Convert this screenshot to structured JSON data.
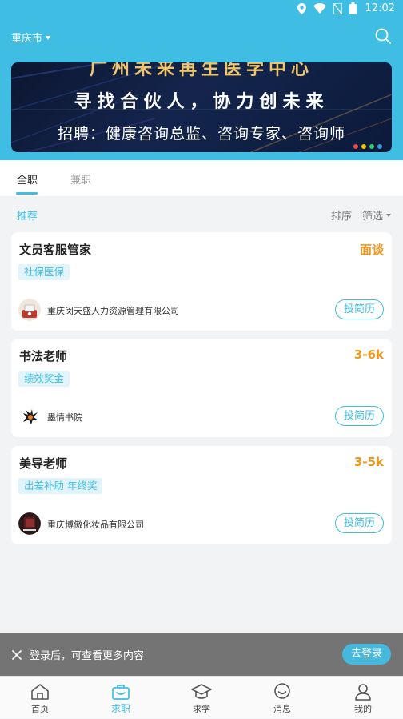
{
  "status_bar": {
    "time": "12:02"
  },
  "header": {
    "city": "重庆市"
  },
  "banner": {
    "line1": "广州未来再生医学中心",
    "line2": "寻找合伙人，协力创未来",
    "line3": "招聘：健康咨询总监、咨询专家、咨询师"
  },
  "tabs": {
    "fulltime": "全职",
    "parttime": "兼职"
  },
  "filter": {
    "recommend": "推荐",
    "sort": "排序",
    "filter": "筛选"
  },
  "jobs": [
    {
      "title": "文员客服管家",
      "salary": "面谈",
      "tag": "社保医保",
      "company": "重庆闵天盛人力资源管理有限公司",
      "apply": "投简历"
    },
    {
      "title": "书法老师",
      "salary": "3-6k",
      "tag": "绩效奖金",
      "company": "墨情书院",
      "apply": "投简历"
    },
    {
      "title": "美导老师",
      "salary": "3-5k",
      "tag": "出差补助 年终奖",
      "company": "重庆博傲化妆品有限公司",
      "apply": "投简历"
    }
  ],
  "login_bar": {
    "text": "登录后，可查看更多内容",
    "button": "去登录"
  },
  "nav": {
    "home": "首页",
    "jobs": "求职",
    "study": "求学",
    "messages": "消息",
    "mine": "我的"
  },
  "colors": {
    "primary": "#3fbde3",
    "salary": "#f0961e",
    "login_bar": "#747474"
  }
}
